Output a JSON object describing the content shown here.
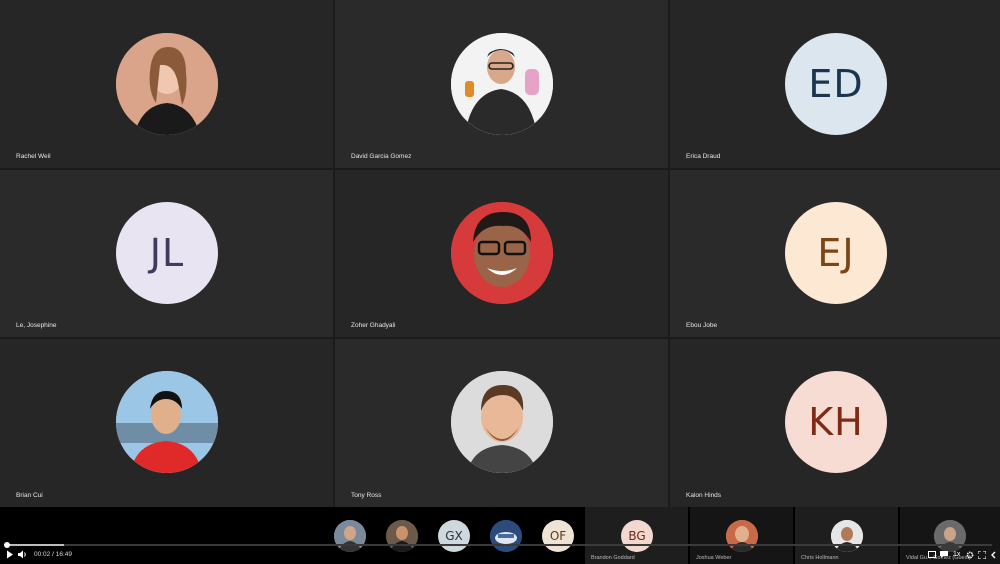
{
  "participants": [
    {
      "name": "Rachel Weil",
      "type": "photo",
      "bg": "#d9a48a",
      "hair": "#8a5a3a",
      "shirt": "#1a1a1a"
    },
    {
      "name": "David Garcia Gomez",
      "type": "photo",
      "bg": "#f3f3f3",
      "hair": "#2b2b2b",
      "shirt": "#2a2a2a"
    },
    {
      "name": "Erica Draud",
      "type": "initials",
      "initials": "ED",
      "bg": "#dbe6ee",
      "fg": "#1b3550"
    },
    {
      "name": "Le, Josephine",
      "type": "initials",
      "initials": "JL",
      "bg": "#e9e4f2",
      "fg": "#403a5e"
    },
    {
      "name": "Zoher Ghadyali",
      "type": "photo",
      "bg": "#d73a3a",
      "hair": "#1f1a18",
      "shirt": "#c52a2a"
    },
    {
      "name": "Ebou Jobe",
      "type": "initials",
      "initials": "EJ",
      "bg": "#fde8d4",
      "fg": "#7a4616"
    },
    {
      "name": "Brian Cui",
      "type": "photo",
      "bg": "#9cc6e6",
      "hair": "#111",
      "shirt": "#e02a2a"
    },
    {
      "name": "Tony Ross",
      "type": "photo",
      "bg": "#dcdcdc",
      "hair": "#5a3a24",
      "shirt": "#444"
    },
    {
      "name": "Kalon Hinds",
      "type": "initials",
      "initials": "KH",
      "bg": "#f7dcd3",
      "fg": "#7e2a14"
    }
  ],
  "strip": [
    {
      "type": "photo",
      "bg": "#7a8a9a",
      "label": ""
    },
    {
      "type": "photo",
      "bg": "#6b5a4a",
      "label": ""
    },
    {
      "type": "initials",
      "initials": "GX",
      "bg": "#cfd8dc",
      "fg": "#24333f",
      "label": ""
    },
    {
      "type": "photo",
      "bg": "#2c4a7a",
      "label": ""
    },
    {
      "type": "initials",
      "initials": "OF",
      "bg": "#efe3d6",
      "fg": "#5a3a1a",
      "label": ""
    }
  ],
  "panels": [
    {
      "name": "Brandon Goddard",
      "type": "initials",
      "initials": "BG",
      "bg": "#f2d8cf",
      "fg": "#6a2a1a"
    },
    {
      "name": "Joshua Weber",
      "type": "photo",
      "bg": "#c86a4a"
    },
    {
      "name": "Chris Hollmann",
      "type": "photo",
      "bg": "#e6e6e6"
    },
    {
      "name": "Vidal Gu... Gomez (Guest)",
      "type": "photo",
      "bg": "#6a6a6a"
    }
  ],
  "player": {
    "current_time": "00:02",
    "separator": "/",
    "duration": "16:49",
    "speed": "1x",
    "progress": 0.002
  },
  "icons": {
    "play": "play-icon",
    "volume": "volume-icon",
    "captions": "captions-icon",
    "chat": "chat-icon",
    "settings": "settings-icon",
    "fullscreen": "fullscreen-icon",
    "exit": "exit-icon"
  }
}
